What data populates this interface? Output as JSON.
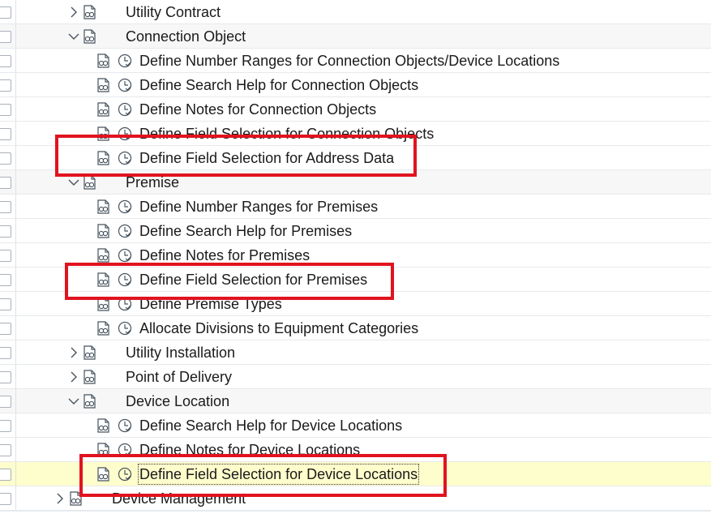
{
  "tree": {
    "rows": [
      {
        "label": "Utility Contract",
        "expand": "collapsed"
      },
      {
        "label": "Connection Object",
        "expand": "expanded"
      },
      {
        "label": "Define Number Ranges for Connection Objects/Device Locations"
      },
      {
        "label": "Define Search Help for Connection Objects"
      },
      {
        "label": "Define Notes for Connection Objects"
      },
      {
        "label": "Define Field Selection for Connection Objects"
      },
      {
        "label": "Define Field Selection for Address Data"
      },
      {
        "label": "Premise",
        "expand": "expanded"
      },
      {
        "label": "Define Number Ranges for Premises"
      },
      {
        "label": "Define Search Help for Premises"
      },
      {
        "label": "Define Notes for Premises"
      },
      {
        "label": "Define Field Selection for Premises"
      },
      {
        "label": "Define Premise Types"
      },
      {
        "label": "Allocate Divisions to Equipment Categories"
      },
      {
        "label": "Utility Installation",
        "expand": "collapsed"
      },
      {
        "label": "Point of Delivery",
        "expand": "collapsed"
      },
      {
        "label": "Device Location",
        "expand": "expanded"
      },
      {
        "label": "Define Search Help for Device Locations"
      },
      {
        "label": "Define Notes for Device Locations"
      },
      {
        "label": "Define Field Selection for Device Locations",
        "selected": true
      },
      {
        "label": "Device Management",
        "expand": "collapsed"
      }
    ]
  },
  "icons": {
    "folder_node": "img-activity-icon",
    "execute": "clock-check-icon",
    "expand": "chevron-right-icon",
    "collapse": "chevron-down-icon"
  },
  "colors": {
    "highlight_row": "#fefdcc",
    "annotation_red": "#e1131f",
    "icon_stroke": "#47535e"
  }
}
